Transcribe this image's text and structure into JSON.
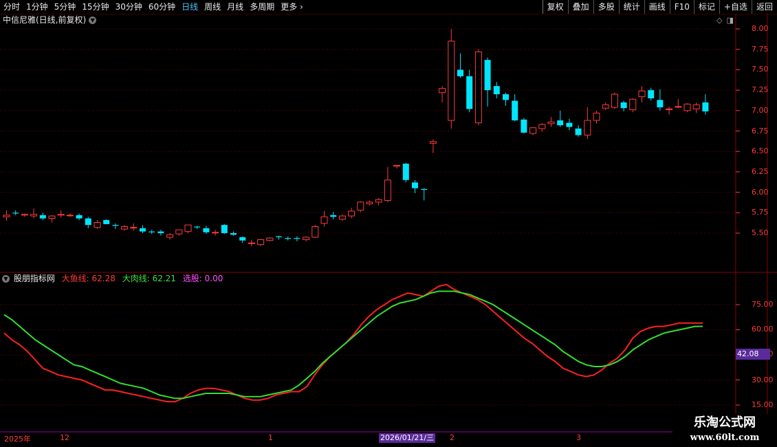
{
  "toolbar": {
    "period_tabs": [
      "分时",
      "1分钟",
      "5分钟",
      "15分钟",
      "30分钟",
      "60分钟",
      "日线",
      "周线",
      "月线",
      "多周期",
      "更多"
    ],
    "active_tab": "日线",
    "right_tools": [
      "复权",
      "叠加",
      "多股",
      "统计",
      "画线",
      "F10",
      "标记",
      "+自选",
      "返回"
    ]
  },
  "stock_title": "中信尼雅(日线,前复权)",
  "indicator": {
    "name": "股朋指标网",
    "line1": "大鱼线: 62.28",
    "line2": "大肉线: 62.21",
    "line3": "选股: 0.00"
  },
  "price_axis": [
    "8.00",
    "7.75",
    "7.50",
    "7.25",
    "7.00",
    "6.75",
    "6.50",
    "6.25",
    "6.00",
    "5.75",
    "5.50"
  ],
  "indicator_axis": [
    "75.00",
    "60.00",
    "45.00",
    "30.00",
    "15.00"
  ],
  "indicator_current": "42.08",
  "time_axis": [
    {
      "label": "2025年"
    },
    {
      "label": "12"
    },
    {
      "label": "1"
    },
    {
      "label": "2"
    },
    {
      "label": "3"
    }
  ],
  "current_date": "2026/01/21/三",
  "watermark": {
    "title": "乐淘公式网",
    "url": "www.60lt.com"
  },
  "colors": {
    "up": "#ff3b3b",
    "down": "#00e5ff",
    "line_fish": "#ff2020",
    "line_meat": "#30e030",
    "grid": "#7a0000"
  },
  "chart_data": {
    "type": "candlestick",
    "candles": [
      [
        5.7,
        5.78,
        5.65,
        5.72
      ],
      [
        5.75,
        5.78,
        5.72,
        5.74
      ],
      [
        5.72,
        5.74,
        5.7,
        5.73
      ],
      [
        5.71,
        5.8,
        5.68,
        5.73
      ],
      [
        5.72,
        5.75,
        5.66,
        5.68
      ],
      [
        5.68,
        5.72,
        5.63,
        5.71
      ],
      [
        5.72,
        5.78,
        5.69,
        5.73
      ],
      [
        5.72,
        5.74,
        5.7,
        5.72
      ],
      [
        5.72,
        5.74,
        5.66,
        5.68
      ],
      [
        5.68,
        5.7,
        5.56,
        5.6
      ],
      [
        5.57,
        5.66,
        5.55,
        5.63
      ],
      [
        5.66,
        5.67,
        5.61,
        5.61
      ],
      [
        5.6,
        5.62,
        5.55,
        5.59
      ],
      [
        5.55,
        5.6,
        5.53,
        5.58
      ],
      [
        5.57,
        5.62,
        5.53,
        5.57
      ],
      [
        5.56,
        5.6,
        5.5,
        5.52
      ],
      [
        5.52,
        5.54,
        5.49,
        5.51
      ],
      [
        5.52,
        5.54,
        5.47,
        5.5
      ],
      [
        5.45,
        5.5,
        5.42,
        5.48
      ],
      [
        5.49,
        5.54,
        5.47,
        5.54
      ],
      [
        5.52,
        5.6,
        5.5,
        5.6
      ],
      [
        5.58,
        5.59,
        5.55,
        5.57
      ],
      [
        5.56,
        5.59,
        5.49,
        5.51
      ],
      [
        5.51,
        5.54,
        5.47,
        5.51
      ],
      [
        5.6,
        5.61,
        5.49,
        5.5
      ],
      [
        5.5,
        5.52,
        5.47,
        5.48
      ],
      [
        5.45,
        5.46,
        5.38,
        5.41
      ],
      [
        5.38,
        5.42,
        5.34,
        5.38
      ],
      [
        5.36,
        5.43,
        5.34,
        5.42
      ],
      [
        5.41,
        5.45,
        5.4,
        5.44
      ],
      [
        5.46,
        5.47,
        5.42,
        5.45
      ],
      [
        5.44,
        5.46,
        5.41,
        5.43
      ],
      [
        5.44,
        5.46,
        5.4,
        5.43
      ],
      [
        5.42,
        5.46,
        5.4,
        5.45
      ],
      [
        5.45,
        5.6,
        5.44,
        5.58
      ],
      [
        5.62,
        5.77,
        5.58,
        5.7
      ],
      [
        5.72,
        5.76,
        5.67,
        5.7
      ],
      [
        5.67,
        5.73,
        5.65,
        5.71
      ],
      [
        5.71,
        5.81,
        5.68,
        5.77
      ],
      [
        5.78,
        5.89,
        5.76,
        5.88
      ],
      [
        5.86,
        5.9,
        5.84,
        5.88
      ],
      [
        5.88,
        5.93,
        5.84,
        5.91
      ],
      [
        5.9,
        6.31,
        5.88,
        6.15
      ],
      [
        6.32,
        6.33,
        6.29,
        6.33
      ],
      [
        6.35,
        6.36,
        6.12,
        6.15
      ],
      [
        6.12,
        6.15,
        5.99,
        6.05
      ],
      [
        6.04,
        6.05,
        5.9,
        6.03
      ],
      [
        6.6,
        6.65,
        6.48,
        6.62
      ],
      [
        7.22,
        7.3,
        7.1,
        7.27
      ],
      [
        6.88,
        8.0,
        6.78,
        7.85
      ],
      [
        7.5,
        7.7,
        7.4,
        7.42
      ],
      [
        7.42,
        7.5,
        6.98,
        7.02
      ],
      [
        6.85,
        7.75,
        6.82,
        7.72
      ],
      [
        7.62,
        7.65,
        7.05,
        7.25
      ],
      [
        7.3,
        7.35,
        7.15,
        7.2
      ],
      [
        7.2,
        7.22,
        7.06,
        7.13
      ],
      [
        7.12,
        7.2,
        6.87,
        6.88
      ],
      [
        6.89,
        6.91,
        6.72,
        6.73
      ],
      [
        6.72,
        6.8,
        6.7,
        6.79
      ],
      [
        6.78,
        6.85,
        6.74,
        6.83
      ],
      [
        6.84,
        6.92,
        6.8,
        6.86
      ],
      [
        6.88,
        7.0,
        6.8,
        6.82
      ],
      [
        6.85,
        6.9,
        6.76,
        6.8
      ],
      [
        6.78,
        6.82,
        6.68,
        6.7
      ],
      [
        6.7,
        7.04,
        6.65,
        6.88
      ],
      [
        6.88,
        7.0,
        6.84,
        6.97
      ],
      [
        7.03,
        7.1,
        7.01,
        7.07
      ],
      [
        7.04,
        7.22,
        7.02,
        7.2
      ],
      [
        7.1,
        7.12,
        6.99,
        7.03
      ],
      [
        7.01,
        7.15,
        6.98,
        7.14
      ],
      [
        7.17,
        7.3,
        7.1,
        7.24
      ],
      [
        7.25,
        7.28,
        7.12,
        7.15
      ],
      [
        7.13,
        7.26,
        7.0,
        7.04
      ],
      [
        7.02,
        7.05,
        6.95,
        7.02
      ],
      [
        7.05,
        7.14,
        7.03,
        7.05
      ],
      [
        7.0,
        7.09,
        6.98,
        7.08
      ],
      [
        7.02,
        7.1,
        6.97,
        7.07
      ],
      [
        7.1,
        7.2,
        6.95,
        6.99
      ]
    ],
    "fish_line": [
      58,
      54,
      51,
      47,
      42,
      37,
      35,
      33,
      32,
      31,
      30,
      28,
      26,
      24,
      24,
      23,
      22,
      21,
      20,
      19,
      18,
      17,
      17,
      19,
      22,
      24,
      25,
      25,
      24,
      23,
      21,
      19,
      18,
      18,
      19,
      21,
      22,
      23,
      23,
      26,
      33,
      39,
      44,
      48,
      52,
      57,
      63,
      68,
      72,
      75,
      78,
      80,
      82,
      81,
      80,
      83,
      86,
      87,
      84,
      82,
      80,
      78,
      75,
      71,
      67,
      63,
      59,
      55,
      52,
      48,
      44,
      41,
      37,
      35,
      33,
      32,
      33,
      36,
      40,
      43,
      48,
      55,
      59,
      61,
      62,
      62,
      63,
      64,
      64,
      64,
      64
    ],
    "meat_line": [
      69,
      66,
      62,
      58,
      54,
      51,
      48,
      45,
      42,
      39,
      38,
      36,
      34,
      32,
      30,
      28,
      27,
      26,
      25,
      23,
      21,
      20,
      19,
      19,
      20,
      21,
      22,
      22,
      22,
      22,
      21,
      20,
      20,
      20,
      21,
      22,
      23,
      24,
      27,
      31,
      35,
      40,
      44,
      48,
      52,
      56,
      60,
      64,
      68,
      71,
      74,
      76,
      77,
      78,
      80,
      82,
      83,
      83,
      83,
      82,
      81,
      79,
      77,
      75,
      72,
      69,
      66,
      63,
      60,
      57,
      54,
      51,
      47,
      44,
      41,
      39,
      38,
      38,
      39,
      41,
      44,
      48,
      51,
      54,
      56,
      58,
      59,
      60,
      61,
      62,
      62
    ]
  }
}
